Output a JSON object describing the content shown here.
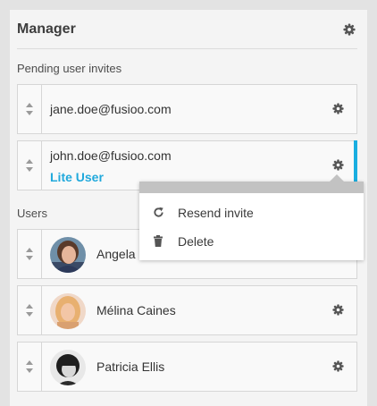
{
  "panel": {
    "title": "Manager"
  },
  "pending": {
    "label": "Pending user invites",
    "invites": [
      {
        "email": "jane.doe@fusioo.com",
        "role": ""
      },
      {
        "email": "john.doe@fusioo.com",
        "role": "Lite User"
      }
    ]
  },
  "users": {
    "label": "Users",
    "list": [
      {
        "name": "Angela F"
      },
      {
        "name": "Mélina Caines"
      },
      {
        "name": "Patricia Ellis"
      }
    ]
  },
  "menu": {
    "items": [
      {
        "label": "Resend invite",
        "icon": "refresh-icon"
      },
      {
        "label": "Delete",
        "icon": "trash-icon"
      }
    ]
  },
  "colors": {
    "accent": "#1aaee0",
    "role": "#21a9dc",
    "icon": "#555555"
  }
}
